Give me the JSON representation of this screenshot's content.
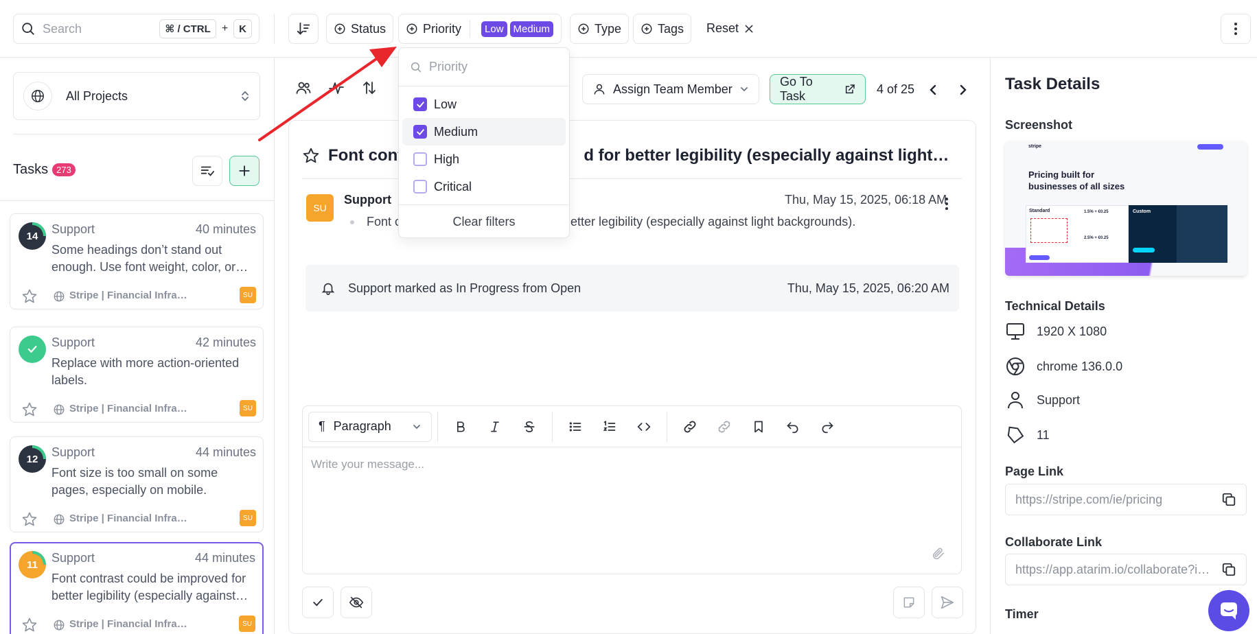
{
  "topbar": {
    "search_placeholder": "Search",
    "shortcut_key1": "⌘ / CTRL",
    "shortcut_plus": "+",
    "shortcut_key2": "K",
    "filters": {
      "status": "Status",
      "priority": "Priority",
      "priority_selected": [
        "Low",
        "Medium"
      ],
      "type": "Type",
      "tags": "Tags"
    },
    "reset_label": "Reset"
  },
  "priority_dropdown": {
    "search_placeholder": "Priority",
    "options": [
      {
        "label": "Low",
        "checked": true
      },
      {
        "label": "Medium",
        "checked": true
      },
      {
        "label": "High",
        "checked": false
      },
      {
        "label": "Critical",
        "checked": false
      }
    ],
    "clear_label": "Clear filters"
  },
  "sidebar": {
    "project_selector": "All Projects",
    "tasks_title": "Tasks",
    "tasks_count": "273",
    "tasks": [
      {
        "number": "14",
        "title": "Support",
        "time": "40 minutes",
        "desc": "Some headings don’t stand out enough. Use font weight, color, or…",
        "project": "Stripe | Financial Infra…",
        "assignee": "SU",
        "avatar_color": "#2b3240"
      },
      {
        "number": "",
        "title": "Support",
        "time": "42 minutes",
        "desc": "Replace with more action-oriented labels.",
        "project": "Stripe | Financial Infra…",
        "assignee": "SU",
        "avatar_color": "#3ccb8c"
      },
      {
        "number": "12",
        "title": "Support",
        "time": "44 minutes",
        "desc": "Font size is too small on some pages, especially on mobile.",
        "project": "Stripe | Financial Infra…",
        "assignee": "SU",
        "avatar_color": "#2b3240"
      },
      {
        "number": "11",
        "title": "Support",
        "time": "44 minutes",
        "desc": "Font contrast could be improved for better legibility (especially against…",
        "project": "Stripe | Financial Infra…",
        "assignee": "SU",
        "avatar_color": "#f6a52c"
      }
    ]
  },
  "task": {
    "assign_label": "Assign Team Member",
    "goto_label": "Go To Task",
    "pager": "4 of 25",
    "title_left": "Font cont",
    "title_right": "d for better legibility (especially against light…",
    "comment": {
      "avatar": "SU",
      "author": "Support",
      "date": "Thu, May 15, 2025, 06:18 AM",
      "text_left": "Font c",
      "text_right": "etter legibility (especially against light backgrounds)."
    },
    "activity": {
      "text": "Support marked as In Progress from Open",
      "date": "Thu, May 15, 2025, 06:20 AM"
    },
    "editor": {
      "paragraph_label": "Paragraph",
      "placeholder": "Write your message..."
    }
  },
  "details": {
    "title": "Task Details",
    "screenshot_label": "Screenshot",
    "screenshot_preview": {
      "logo": "stripe",
      "headline_line1": "Pricing built for",
      "headline_line2": "businesses of all sizes",
      "plan_standard": "Standard",
      "price1": "1.5% + €0.25",
      "price2": "2.5% + €0.25",
      "plan_custom": "Custom"
    },
    "technical_label": "Technical Details",
    "resolution": "1920 X 1080",
    "browser": "chrome 136.0.0",
    "user": "Support",
    "task_id": "11",
    "page_link_label": "Page Link",
    "page_link": "https://stripe.com/ie/pricing",
    "collab_label": "Collaborate Link",
    "collab_link": "https://app.atarim.io/collaborate?i…",
    "timer_label": "Timer"
  },
  "colors": {
    "accent": "#6d4ae6",
    "green": "#3ccb8c",
    "orange": "#f6a52c",
    "pink": "#e93b73",
    "arrow": "#e8262b"
  }
}
